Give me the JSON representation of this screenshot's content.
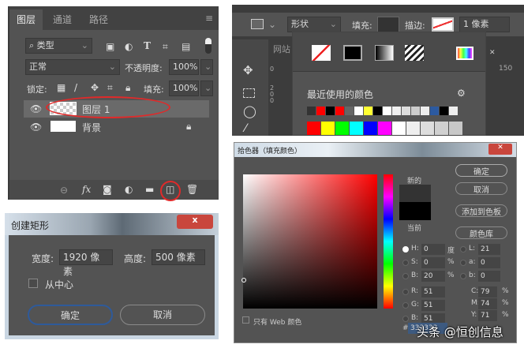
{
  "layers_panel": {
    "tabs": [
      "图层",
      "通道",
      "路径"
    ],
    "filter_kind": "类型",
    "blend_mode": "正常",
    "opacity_label": "不透明度:",
    "opacity": "100%",
    "lock_label": "锁定:",
    "fill_label": "填充:",
    "fill": "100%",
    "layers": [
      {
        "name": "图层 1"
      },
      {
        "name": "背景"
      }
    ],
    "footer_fx": "fx"
  },
  "options_bar": {
    "shape_mode": "形状",
    "fill_label": "填充:",
    "stroke_label": "描边:",
    "stroke_width": "1 像素",
    "doc_tab": "网站",
    "ruler_value": "150",
    "ruler_left": [
      "0",
      "2",
      "0",
      "0"
    ],
    "popup": {
      "recent_label": "最近使用的颜色",
      "recent_colors": [
        "#333333",
        "#ff0000",
        "#000000",
        "#ff0000",
        "#666666",
        "#ffffff",
        "#ffff33",
        "#000000",
        "#ffffff",
        "#f0f0f0",
        "#dddddd",
        "#cccccc",
        "#eeeeee",
        "#2c5aa0",
        "#000000",
        "#eeeeee"
      ],
      "grid_colors": [
        "#ff0000",
        "#ffff00",
        "#00ff00",
        "#00ffff",
        "#0000ff",
        "#ff00ff",
        "#ffffff",
        "#eeeeee",
        "#dddddd",
        "#d0d0d0",
        "#c8c8c8"
      ]
    }
  },
  "color_picker": {
    "title": "拾色器（填充颜色）",
    "new_label": "新的",
    "current_label": "当前",
    "buttons": [
      "确定",
      "取消",
      "添加到色板",
      "颜色库"
    ],
    "new_color": "#333333",
    "current_color": "#000000",
    "fields_left": [
      {
        "label": "H:",
        "value": "0",
        "unit": "度"
      },
      {
        "label": "S:",
        "value": "0",
        "unit": "%"
      },
      {
        "label": "B:",
        "value": "20",
        "unit": "%"
      },
      {
        "label": "R:",
        "value": "51",
        "unit": ""
      },
      {
        "label": "G:",
        "value": "51",
        "unit": ""
      },
      {
        "label": "B:",
        "value": "51",
        "unit": ""
      }
    ],
    "fields_lab": [
      {
        "label": "L:",
        "value": "21"
      },
      {
        "label": "a:",
        "value": "0"
      },
      {
        "label": "b:",
        "value": "0"
      }
    ],
    "fields_cmyk": [
      {
        "label": "C:",
        "value": "79",
        "unit": "%"
      },
      {
        "label": "M:",
        "value": "74",
        "unit": "%"
      },
      {
        "label": "Y:",
        "value": "71",
        "unit": "%"
      }
    ],
    "hex_label": "#",
    "hex": "333333",
    "web_only": "只有 Web 颜色"
  },
  "rect_dialog": {
    "title": "创建矩形",
    "close": "x",
    "width_label": "宽度:",
    "width": "1920 像素",
    "height_label": "高度:",
    "height": "500 像素",
    "from_center": "从中心",
    "ok": "确定",
    "cancel": "取消"
  },
  "watermark": "头条 @恒创信息"
}
